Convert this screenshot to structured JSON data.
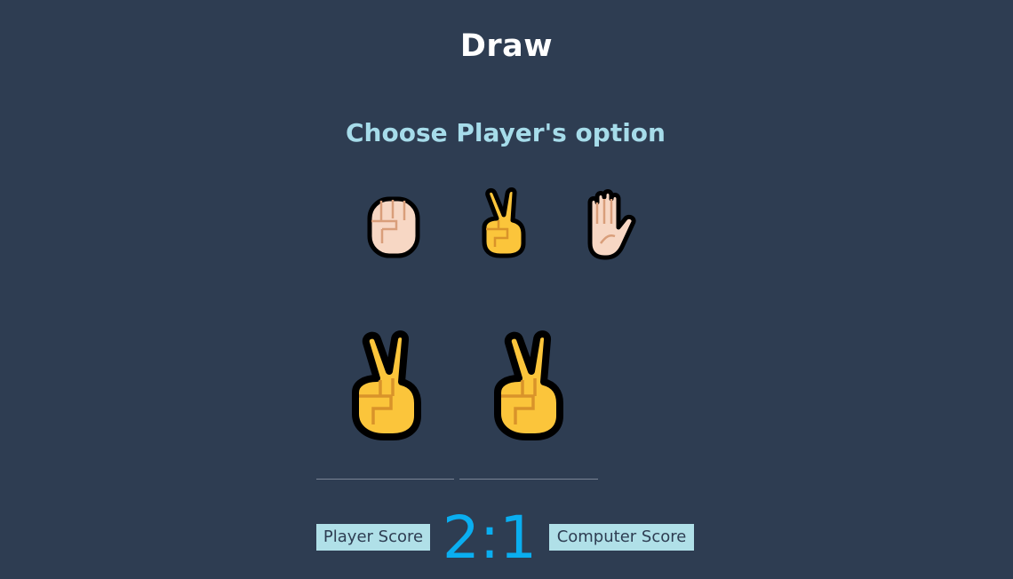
{
  "result": {
    "title": "Draw"
  },
  "choose": {
    "title": "Choose Player's option"
  },
  "options": [
    {
      "name": "rock",
      "icon": "raised-fist-icon"
    },
    {
      "name": "scissors",
      "icon": "victory-hand-icon"
    },
    {
      "name": "paper",
      "icon": "raised-hand-icon"
    }
  ],
  "battle": {
    "player_choice_icon": "victory-hand-icon",
    "computer_choice_icon": "victory-hand-icon"
  },
  "score": {
    "player_label": "Player Score",
    "computer_label": "Computer Score",
    "value": "2:1"
  },
  "colors": {
    "background": "#2e3d52",
    "subtitle": "#a6dcea",
    "score_value": "#0aaef0",
    "label_background": "#b0e0e8",
    "skin_light": "#f7d7c4",
    "skin_yellow": "#fbc53b"
  }
}
